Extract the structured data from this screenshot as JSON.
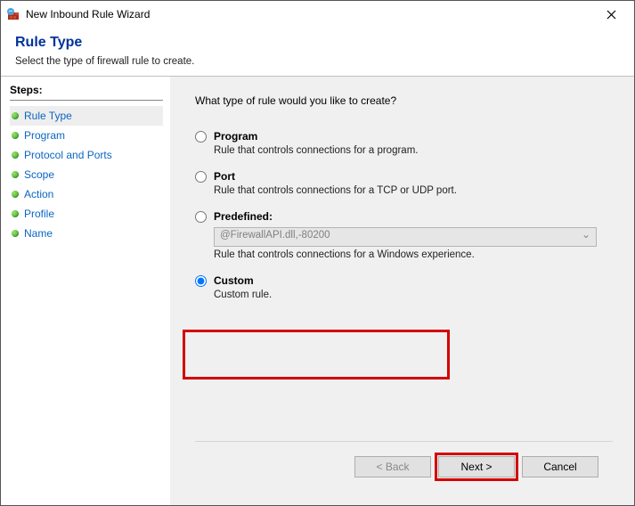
{
  "window": {
    "title": "New Inbound Rule Wizard"
  },
  "header": {
    "heading": "Rule Type",
    "subtitle": "Select the type of firewall rule to create."
  },
  "steps": {
    "title": "Steps:",
    "items": [
      {
        "label": "Rule Type",
        "current": true
      },
      {
        "label": "Program",
        "current": false
      },
      {
        "label": "Protocol and Ports",
        "current": false
      },
      {
        "label": "Scope",
        "current": false
      },
      {
        "label": "Action",
        "current": false
      },
      {
        "label": "Profile",
        "current": false
      },
      {
        "label": "Name",
        "current": false
      }
    ]
  },
  "content": {
    "prompt": "What type of rule would you like to create?",
    "options": {
      "program": {
        "label": "Program",
        "desc": "Rule that controls connections for a program."
      },
      "port": {
        "label": "Port",
        "desc": "Rule that controls connections for a TCP or UDP port."
      },
      "predefined": {
        "label": "Predefined:",
        "selected": "@FirewallAPI.dll,-80200",
        "desc": "Rule that controls connections for a Windows experience."
      },
      "custom": {
        "label": "Custom",
        "desc": "Custom rule."
      }
    },
    "selected_option": "custom"
  },
  "footer": {
    "back": "< Back",
    "next": "Next >",
    "cancel": "Cancel"
  }
}
